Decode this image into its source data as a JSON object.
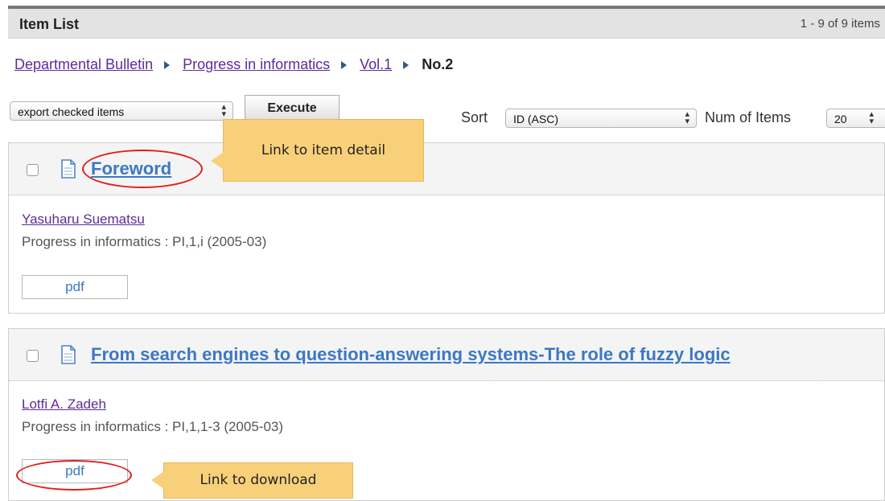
{
  "header": {
    "title": "Item List",
    "count": "1 - 9 of 9 items"
  },
  "breadcrumb": {
    "items": [
      "Departmental Bulletin",
      "Progress in informatics",
      "Vol.1"
    ],
    "current": "No.2"
  },
  "toolbar": {
    "export_select": "export checked items",
    "execute_label": "Execute",
    "sort_label": "Sort",
    "sort_value": "ID (ASC)",
    "num_items_label": "Num of Items",
    "num_items_value": "20"
  },
  "items": [
    {
      "title": "Foreword",
      "author": "Yasuharu Suematsu",
      "pubinfo": "Progress in informatics : PI,1,i (2005-03)",
      "pdf_label": "pdf"
    },
    {
      "title": "From search engines to question-answering systems-The role of fuzzy logic",
      "author": "Lotfi A. Zadeh",
      "pubinfo": "Progress in informatics : PI,1,1-3 (2005-03)",
      "pdf_label": "pdf"
    }
  ],
  "callouts": {
    "detail": "Link to item detail",
    "download": "Link to  download"
  },
  "icons": {
    "checkbox": "checkbox-icon",
    "document": "document-icon",
    "breadcrumb_separator": "triangle-right-icon",
    "select_arrows": "updown-arrows-icon"
  },
  "colors": {
    "link_blue": "#3b78c4",
    "visited_purple": "#5c2b9a",
    "callout_fill": "#f9d07a",
    "highlight_red": "#e21d1d"
  }
}
